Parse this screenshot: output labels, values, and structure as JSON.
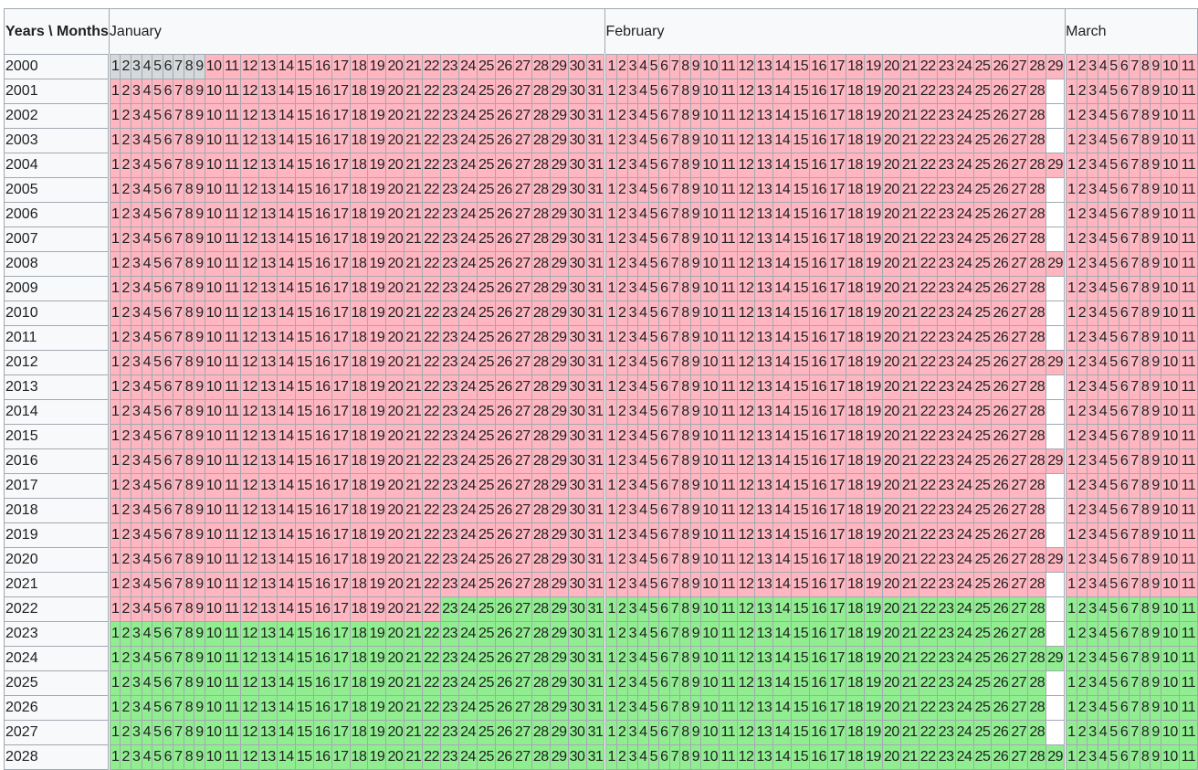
{
  "corner_label": "Years \\ Months",
  "months": [
    {
      "name": "January",
      "days": 31
    },
    {
      "name": "February",
      "days": 29
    },
    {
      "name": "March",
      "days": 11
    }
  ],
  "colors": {
    "greyed": "#d6d9dc",
    "before": "#ffb6c1",
    "after": "#90ee90",
    "empty": "#ffffff"
  },
  "cutoff_date": "2022-01-23",
  "rows": [
    {
      "year": "2000",
      "leap": true,
      "greyed_jan_days": 9
    },
    {
      "year": "2001",
      "leap": false
    },
    {
      "year": "2002",
      "leap": false
    },
    {
      "year": "2003",
      "leap": false
    },
    {
      "year": "2004",
      "leap": true
    },
    {
      "year": "2005",
      "leap": false
    },
    {
      "year": "2006",
      "leap": false
    },
    {
      "year": "2007",
      "leap": false
    },
    {
      "year": "2008",
      "leap": true
    },
    {
      "year": "2009",
      "leap": false
    },
    {
      "year": "2010",
      "leap": false
    },
    {
      "year": "2011",
      "leap": false
    },
    {
      "year": "2012",
      "leap": true
    },
    {
      "year": "2013",
      "leap": false
    },
    {
      "year": "2014",
      "leap": false
    },
    {
      "year": "2015",
      "leap": false
    },
    {
      "year": "2016",
      "leap": true
    },
    {
      "year": "2017",
      "leap": false
    },
    {
      "year": "2018",
      "leap": false
    },
    {
      "year": "2019",
      "leap": false
    },
    {
      "year": "2020",
      "leap": true
    },
    {
      "year": "2021",
      "leap": false
    },
    {
      "year": "2022",
      "leap": false
    },
    {
      "year": "2023",
      "leap": false
    },
    {
      "year": "2024",
      "leap": true
    },
    {
      "year": "2025",
      "leap": false
    },
    {
      "year": "2026",
      "leap": false
    },
    {
      "year": "2027",
      "leap": false
    },
    {
      "year": "2028",
      "leap": true
    }
  ]
}
